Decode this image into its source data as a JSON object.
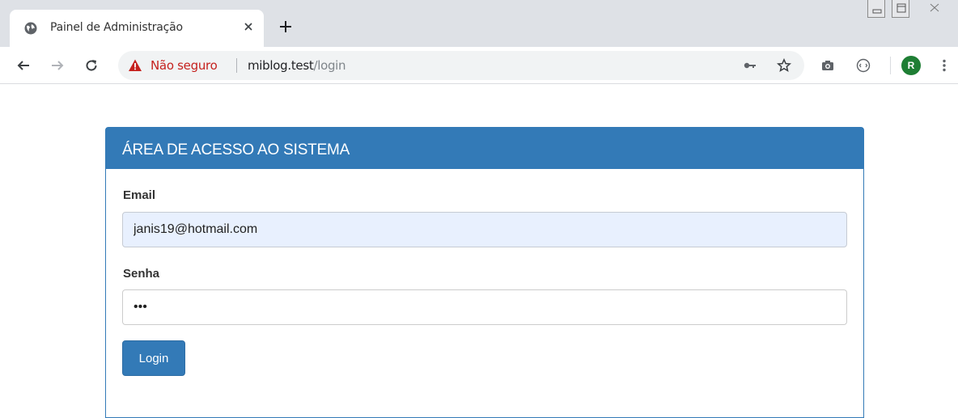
{
  "browser": {
    "tab_title": "Painel de Administração",
    "security_label": "Não seguro",
    "url_host": "miblog.test",
    "url_path": "/login",
    "profile_initial": "R"
  },
  "panel": {
    "heading": "ÁREA DE ACESSO AO SISTEMA"
  },
  "form": {
    "email_label": "Email",
    "email_value": "janis19@hotmail.com",
    "password_label": "Senha",
    "password_value": "•••",
    "login_label": "Login"
  },
  "colors": {
    "primary": "#337ab7",
    "insecure": "#c5221f",
    "autofill": "#e8f0fe"
  }
}
